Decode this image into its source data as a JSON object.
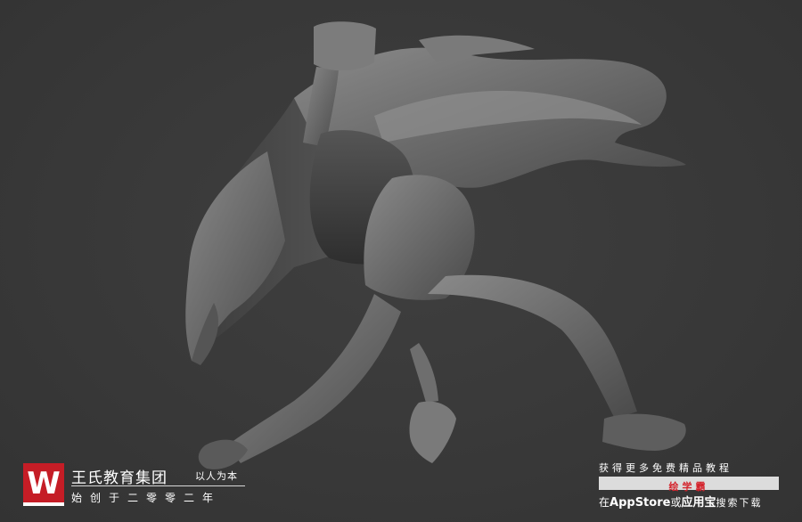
{
  "viewport": {
    "background": "#3a3a3a",
    "subject": "clay sculpt of running figure with flowing cape"
  },
  "brand": {
    "logo_letter": "W",
    "logo_color": "#c51d26",
    "name": "王氏教育集团",
    "slogan": "以人为本",
    "founded": "始创于二零零二年"
  },
  "promo": {
    "line1": "获得更多免费精品教程",
    "highlight": "绘学霸",
    "highlight_color": "#d4232c",
    "line3_prefix": "在",
    "appstore": "AppStore",
    "or": "或",
    "app_store_cn": "应用宝",
    "line3_suffix": "搜索下载"
  }
}
